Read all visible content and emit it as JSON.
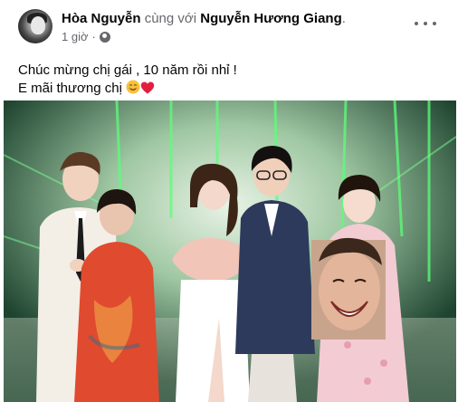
{
  "post": {
    "author": "Hòa Nguyễn",
    "with_text": "cùng với",
    "tagged": "Nguyễn Hương Giang",
    "tagged_suffix": ".",
    "time": "1 giờ",
    "time_sep": "·",
    "privacy_icon": "globe-icon",
    "more_icon": "more-options-icon",
    "caption_line1": "Chúc mừng chị gái , 10 năm rồi nhỉ !",
    "caption_line2": "E mãi thương chị",
    "caption_emojis": [
      "smiling-face-icon",
      "red-heart-icon"
    ]
  },
  "colors": {
    "text_primary": "#050505",
    "text_secondary": "#65676b",
    "heart": "#e41e3f",
    "smile": "#f7c23a"
  }
}
